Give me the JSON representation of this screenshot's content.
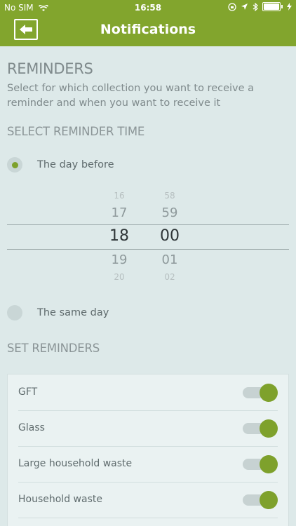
{
  "status": {
    "carrier": "No SIM",
    "time": "16:58"
  },
  "nav": {
    "title": "Notifications",
    "back_icon": "arrow-left-icon"
  },
  "reminders": {
    "heading": "REMINDERS",
    "description": "Select for which collection you want to receive a reminder and when you want to receive it"
  },
  "time_section": {
    "heading": "SELECT REMINDER TIME",
    "options": [
      {
        "label": "The day before",
        "selected": true
      },
      {
        "label": "The same day",
        "selected": false
      }
    ],
    "picker": {
      "hours": [
        "16",
        "17",
        "18",
        "19",
        "20"
      ],
      "minutes": [
        "58",
        "59",
        "00",
        "01",
        "02"
      ],
      "selected_hour": "18",
      "selected_minute": "00"
    }
  },
  "set_reminders": {
    "heading": "SET REMINDERS",
    "items": [
      {
        "label": "GFT",
        "enabled": true
      },
      {
        "label": "Glass",
        "enabled": true
      },
      {
        "label": "Large household waste",
        "enabled": true
      },
      {
        "label": "Household waste",
        "enabled": true
      }
    ]
  },
  "colors": {
    "accent": "#82a52d",
    "background": "#dde9e9",
    "toggle_on": "#7ea12c"
  }
}
